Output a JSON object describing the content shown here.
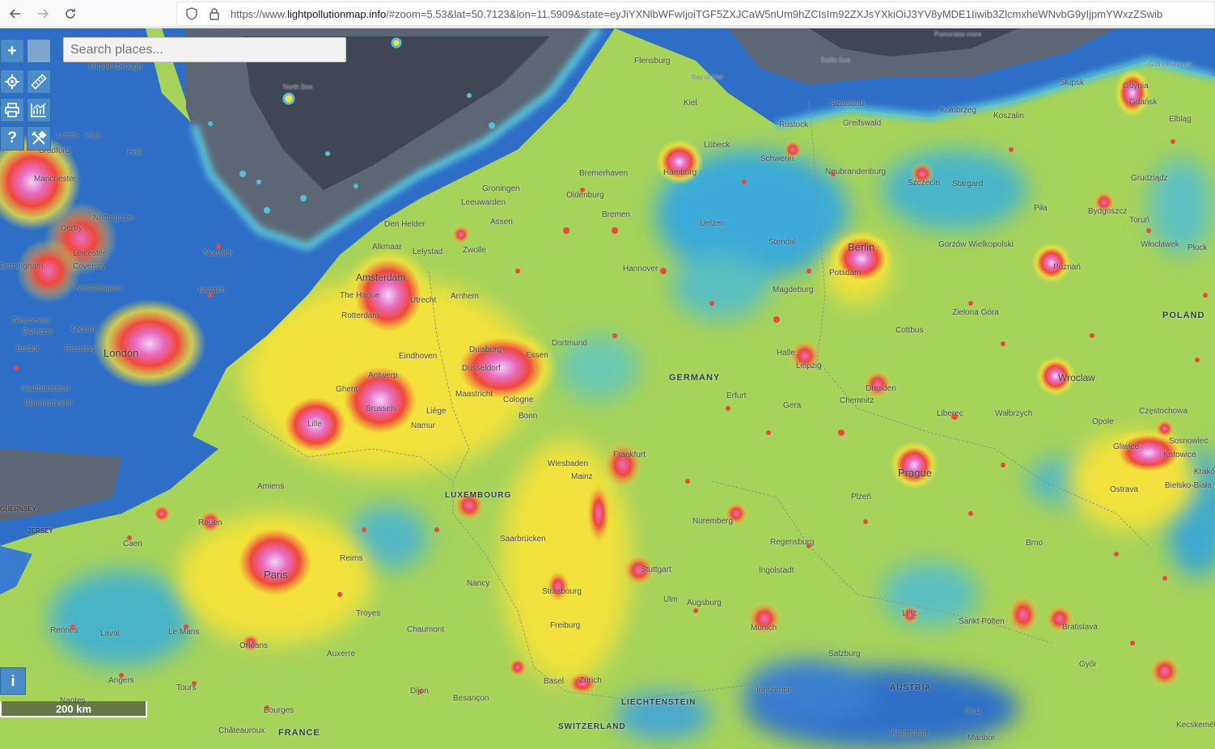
{
  "browser": {
    "back_icon": "arrow-left-icon",
    "forward_icon": "arrow-right-icon",
    "reload_icon": "reload-icon",
    "url_prefix": "https://www.",
    "url_domain": "lightpollutionmap.info",
    "url_rest": "/#zoom=5.53&lat=50.7123&lon=11.5909&state=eyJiYXNlbWFwIjoiTGF5ZXJCaW5nUm9hZCIsIm92ZXJsYXkiOiJ3YV8yMDE1Iiwib3ZlcmxheWNvbG9yIjpmYWxzZSwib"
  },
  "map": {
    "search_placeholder": "Search places...",
    "zoom_in_label": "+",
    "help_label": "?",
    "info_label": "i",
    "scale_label": "200 km",
    "colors": {
      "water": "#2f6fc9",
      "sea_gray": "#5b6574",
      "land_low": "#3bb3c8",
      "land_mid": "#9fd25a",
      "land_high": "#f2e23a",
      "urban": "#f04e3c",
      "core": "#e8b8f0"
    },
    "labels": {
      "countries": [
        "GERMANY",
        "POLAND",
        "LUXEMBOURG",
        "SWITZERLAND",
        "LIECHTENSTEIN",
        "AUSTRIA",
        "FRANCE"
      ],
      "big_cities": [
        "London",
        "Paris",
        "Berlin",
        "Amsterdam",
        "Prague",
        "Wroclaw",
        "Hamburg",
        "Brussels"
      ],
      "cities": [
        "Middlesbrough",
        "Leeds",
        "York",
        "Bradford",
        "Manchester",
        "Hull",
        "Nottingham",
        "Derby",
        "Leicester",
        "Norwich",
        "Coventry",
        "Birmingham",
        "Northampton",
        "Ipswich",
        "Oxford",
        "Reading",
        "Bristol",
        "Swindon",
        "Gloucester",
        "Southampton",
        "Bournemouth",
        "Rotterdam",
        "The Hague",
        "Utrecht",
        "Arnhem",
        "Antwerp",
        "Ghent",
        "Lille",
        "Eindhoven",
        "Liège",
        "Namur",
        "Maastricht",
        "Duisburg",
        "Essen",
        "Dortmund",
        "Düsseldorf",
        "Cologne",
        "Bonn",
        "Groningen",
        "Leeuwarden",
        "Assen",
        "Zwolle",
        "Den Helder",
        "Alkmaar",
        "Lelystad",
        "Oldenburg",
        "Bremerhaven",
        "Bremen",
        "Hannover",
        "Uelzen",
        "Lübeck",
        "Kiel",
        "Flensburg",
        "Schwerin",
        "Rostock",
        "Greifswald",
        "Stralsund",
        "Stendal",
        "Magdeburg",
        "Potsdam",
        "Neubrandenburg",
        "Szczecin",
        "Stargard",
        "Koszalin",
        "Kołobrzeg",
        "Słupsk",
        "Gdynia",
        "Gdańsk",
        "Elbląg",
        "Grudziądz",
        "Bydgoszcz",
        "Toruń",
        "Piła",
        "Gorzów Wielkopolski",
        "Poznań",
        "Włocławek",
        "Płock",
        "Zielona Góra",
        "Cottbus",
        "Halle",
        "Leipzig",
        "Dresden",
        "Chemnitz",
        "Erfurt",
        "Gera",
        "Liberec",
        "Wałbrzych",
        "Opole",
        "Częstochowa",
        "Gliwice",
        "Katowice",
        "Sosnowiec",
        "Kraków",
        "Bielsko-Biała",
        "Ostrava",
        "Brno",
        "Plzeň",
        "Frankfurt",
        "Wiesbaden",
        "Mainz",
        "Saarbrücken",
        "Nancy",
        "Strasbourg",
        "Freiburg",
        "Basel",
        "Zürich",
        "Stuttgart",
        "Nuremberg",
        "Regensburg",
        "Ingolstadt",
        "Ulm",
        "Augsburg",
        "Munich",
        "Salzburg",
        "Linz",
        "Innsbruck",
        "Graz",
        "Klagenfurt",
        "Maribor",
        "Győr",
        "Bratislava",
        "Sankt Pölten",
        "Amiens",
        "Rouen",
        "Caen",
        "Le Mans",
        "Rennes",
        "Laval",
        "Orléans",
        "Tours",
        "Angers",
        "Nantes",
        "Troyes",
        "Auxerre",
        "Chaumont",
        "Dijon",
        "Besançon",
        "Bourges",
        "Châteauroux",
        "Reims",
        "Kecskemét"
      ],
      "seas": [
        "North Sea",
        "Baltic Sea",
        "Bay of Kiel",
        "Gulf of Gdansk",
        "Pomorskie more"
      ],
      "islands": [
        "GUERNSEY",
        "JERSEY"
      ]
    }
  }
}
